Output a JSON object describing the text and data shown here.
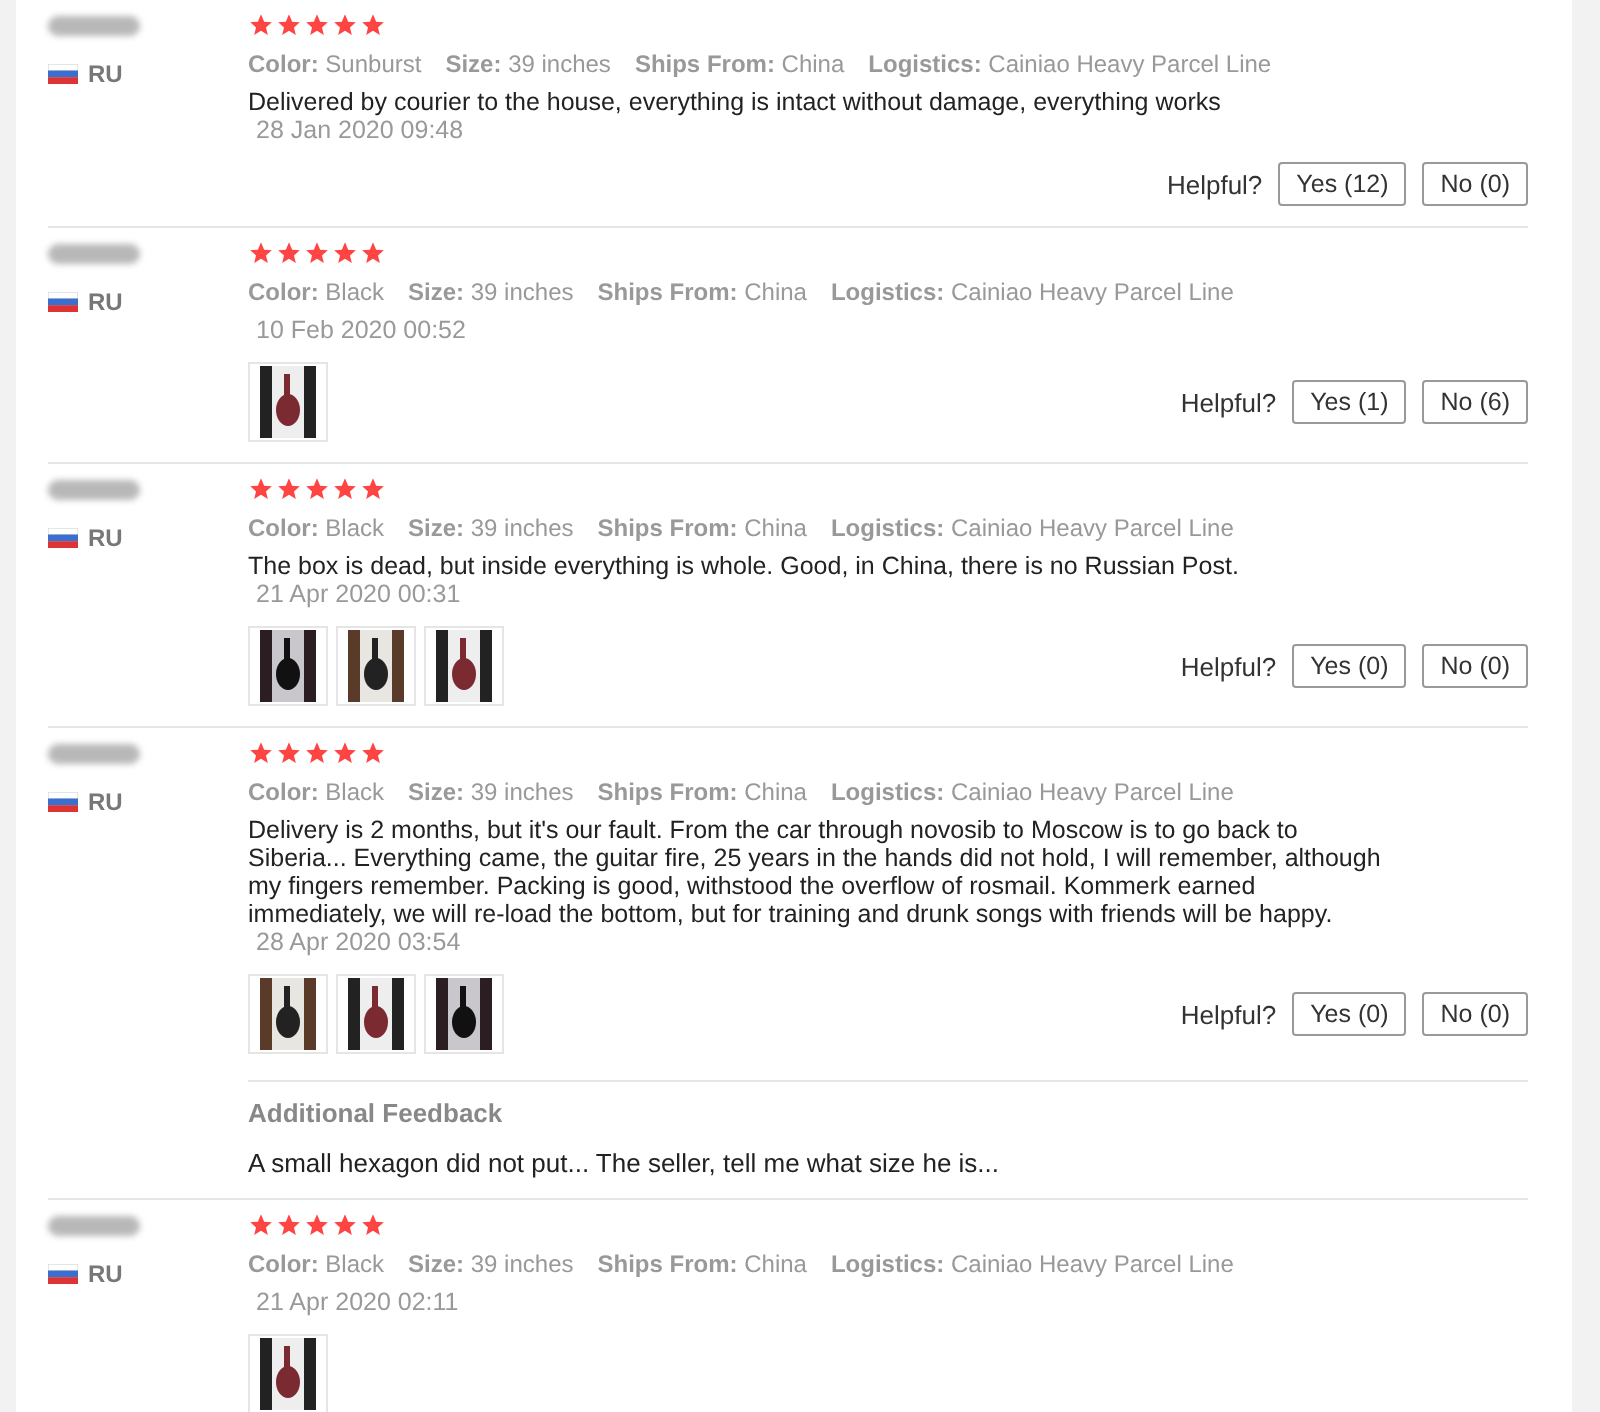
{
  "reviews": [
    {
      "country": "RU",
      "stars": 5,
      "attributes": [
        {
          "label": "Color:",
          "value": "Sunburst"
        },
        {
          "label": "Size:",
          "value": "39 inches"
        },
        {
          "label": "Ships From:",
          "value": "China"
        },
        {
          "label": "Logistics:",
          "value": "Cainiao Heavy Parcel Line"
        }
      ],
      "text": "Delivered by courier to the house, everything is intact without damage, everything works",
      "date": "28 Jan 2020 09:48",
      "helpful": {
        "label": "Helpful?",
        "yes": "Yes (12)",
        "no": "No (0)"
      }
    },
    {
      "country": "RU",
      "stars": 5,
      "attributes": [
        {
          "label": "Color:",
          "value": "Black"
        },
        {
          "label": "Size:",
          "value": "39 inches"
        },
        {
          "label": "Ships From:",
          "value": "China"
        },
        {
          "label": "Logistics:",
          "value": "Cainiao Heavy Parcel Line"
        }
      ],
      "date": "10 Feb 2020 00:52",
      "photos": [
        {
          "kind": "picture"
        }
      ],
      "helpful": {
        "label": "Helpful?",
        "yes": "Yes (1)",
        "no": "No (6)"
      }
    },
    {
      "country": "RU",
      "stars": 5,
      "attributes": [
        {
          "label": "Color:",
          "value": "Black"
        },
        {
          "label": "Size:",
          "value": "39 inches"
        },
        {
          "label": "Ships From:",
          "value": "China"
        },
        {
          "label": "Logistics:",
          "value": "Cainiao Heavy Parcel Line"
        }
      ],
      "text": "The box is dead, but inside everything is whole. Good, in China, there is no Russian Post.",
      "date": "21 Apr 2020 00:31",
      "photos": [
        {
          "kind": "picture"
        },
        {
          "kind": "picture"
        },
        {
          "kind": "picture"
        }
      ],
      "helpful": {
        "label": "Helpful?",
        "yes": "Yes (0)",
        "no": "No (0)"
      }
    },
    {
      "country": "RU",
      "stars": 5,
      "attributes": [
        {
          "label": "Color:",
          "value": "Black"
        },
        {
          "label": "Size:",
          "value": "39 inches"
        },
        {
          "label": "Ships From:",
          "value": "China"
        },
        {
          "label": "Logistics:",
          "value": "Cainiao Heavy Parcel Line"
        }
      ],
      "text": "Delivery is 2 months, but it's our fault. From the car through novosib to Moscow is to go back to Siberia... Everything came, the guitar fire, 25 years in the hands did not hold, I will remember, although my fingers remember. Packing is good, withstood the overflow of rosmail. Kommerk earned immediately, we will re-load the bottom, but for training and drunk songs with friends will be happy.",
      "date": "28 Apr 2020 03:54",
      "photos": [
        {
          "kind": "picture"
        },
        {
          "kind": "picture"
        },
        {
          "kind": "picture"
        }
      ],
      "helpful": {
        "label": "Helpful?",
        "yes": "Yes (0)",
        "no": "No (0)"
      },
      "additional_feedback": {
        "title": "Additional Feedback",
        "text": "A small hexagon did not put... The seller, tell me what size he is..."
      }
    },
    {
      "country": "RU",
      "stars": 5,
      "attributes": [
        {
          "label": "Color:",
          "value": "Black"
        },
        {
          "label": "Size:",
          "value": "39 inches"
        },
        {
          "label": "Ships From:",
          "value": "China"
        },
        {
          "label": "Logistics:",
          "value": "Cainiao Heavy Parcel Line"
        }
      ],
      "date": "21 Apr 2020 02:11",
      "photos": [
        {
          "kind": "picture"
        }
      ]
    }
  ]
}
